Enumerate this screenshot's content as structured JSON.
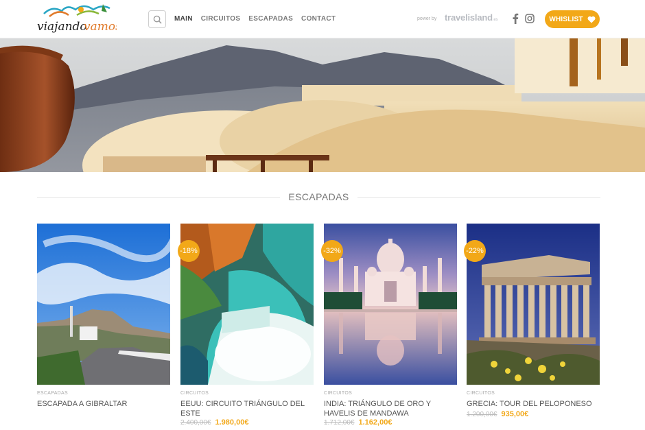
{
  "header": {
    "logo_text": "viajandovamos",
    "nav": [
      "MAIN",
      "CIRCUITOS",
      "ESCAPADAS",
      "CONTACT"
    ],
    "powered_by": "power by",
    "partner": "travelisland",
    "partner_suffix": ".es",
    "wishlist_label": "WHISLIST"
  },
  "section": {
    "title": "ESCAPADAS"
  },
  "products": [
    {
      "category": "ESCAPADAS",
      "title": "ESCAPADA A GIBRALTAR",
      "badge": "",
      "old_price": "",
      "new_price": ""
    },
    {
      "category": "CIRCUITOS",
      "title": "EEUU: CIRCUITO TRIÁNGULO DEL ESTE",
      "badge": "-18%",
      "old_price": "2.400,00€",
      "new_price": "1.980,00€"
    },
    {
      "category": "CIRCUITOS",
      "title": "INDIA: TRIÁNGULO DE ORO Y HAVELIS DE MANDAWA",
      "badge": "-32%",
      "old_price": "1.712,00€",
      "new_price": "1.162,00€"
    },
    {
      "category": "CIRCUITOS",
      "title": "GRECIA: TOUR DEL PELOPONESO",
      "badge": "-22%",
      "old_price": "1.200,00€",
      "new_price": "935,00€"
    }
  ],
  "colors": {
    "accent": "#f2a818",
    "text": "#555555",
    "muted": "#aaaaaa"
  },
  "icons": [
    "search-icon",
    "facebook-icon",
    "instagram-icon",
    "heart-icon"
  ]
}
